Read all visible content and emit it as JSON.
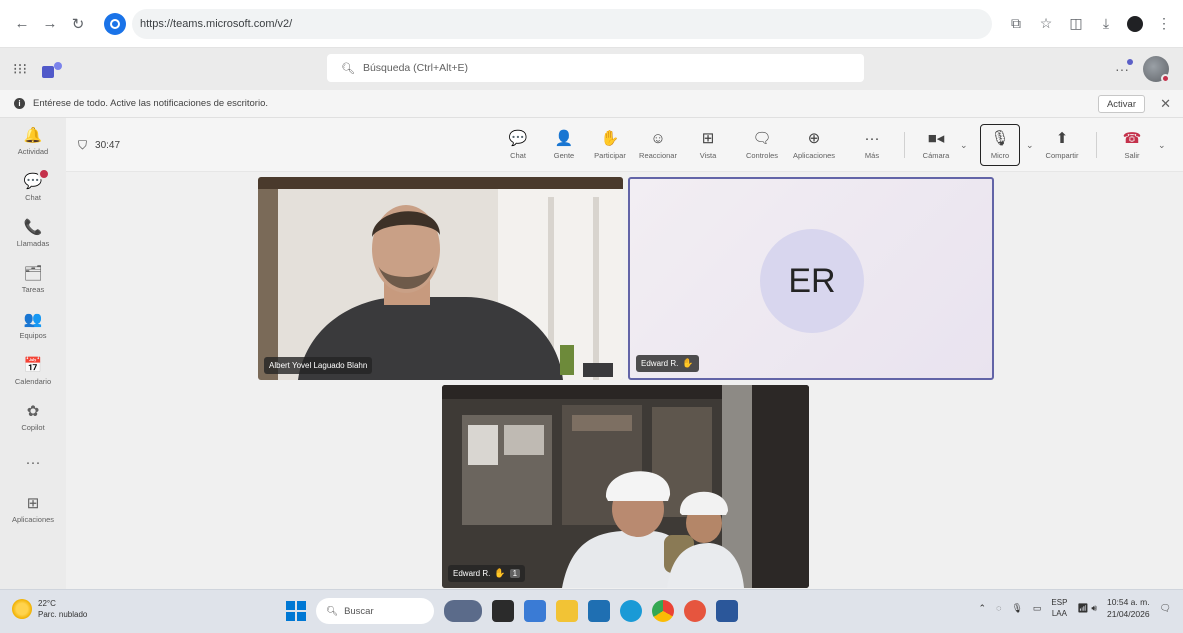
{
  "browser": {
    "url": "https://teams.microsoft.com/v2/",
    "icons": [
      "back-icon",
      "forward-icon",
      "reload-icon",
      "cast-icon",
      "star-icon",
      "extensions-icon",
      "download-icon",
      "profile-icon",
      "menu-icon"
    ]
  },
  "header": {
    "search_placeholder": "Búsqueda (Ctrl+Alt+E)"
  },
  "notice": {
    "text": "Entérese de todo. Active las notificaciones de escritorio.",
    "action": "Activar"
  },
  "rail": {
    "items": [
      {
        "label": "Actividad",
        "icon": "🔔"
      },
      {
        "label": "Chat",
        "icon": "💬"
      },
      {
        "label": "Llamadas",
        "icon": "📞"
      },
      {
        "label": "Tareas",
        "icon": "🗂"
      },
      {
        "label": "Equipos",
        "icon": "👥"
      },
      {
        "label": "Calendario",
        "icon": "📅"
      },
      {
        "label": "Copilot",
        "icon": "✿"
      },
      {
        "label": "",
        "icon": "···"
      },
      {
        "label": "Aplicaciones",
        "icon": "⊞"
      }
    ]
  },
  "toolbar": {
    "timer": "30:47",
    "buttons": [
      {
        "label": "Chat",
        "icon": "💬"
      },
      {
        "label": "Gente",
        "icon": "👤"
      },
      {
        "label": "Participar",
        "icon": "✋"
      },
      {
        "label": "Reaccionar",
        "icon": "☺"
      },
      {
        "label": "Vista",
        "icon": "⊞"
      },
      {
        "label": "Controles",
        "icon": "🗨"
      },
      {
        "label": "Aplicaciones",
        "icon": "⊕"
      },
      {
        "label": "Más",
        "icon": "···"
      }
    ],
    "camera_label": "Cámara",
    "mic_label": "Micro",
    "share_label": "Compartir",
    "leave_label": "Salir"
  },
  "participants": [
    {
      "name": "Albert Yovel Laguado Blahn"
    },
    {
      "name": "Edward R.",
      "initials": "ER"
    },
    {
      "name": "Edward R.",
      "pin": "1"
    }
  ],
  "taskbar": {
    "weather_temp": "22°C",
    "weather_desc": "Parc. nublado",
    "search_placeholder": "Buscar",
    "lang_top": "ESP",
    "lang_bottom": "LAA",
    "time": "10:54 a. m.",
    "date": "21/04/2026"
  },
  "colors": {
    "teams_accent": "#6264a7",
    "leave_red": "#c4314b",
    "windows_blue": "#0078d4"
  }
}
